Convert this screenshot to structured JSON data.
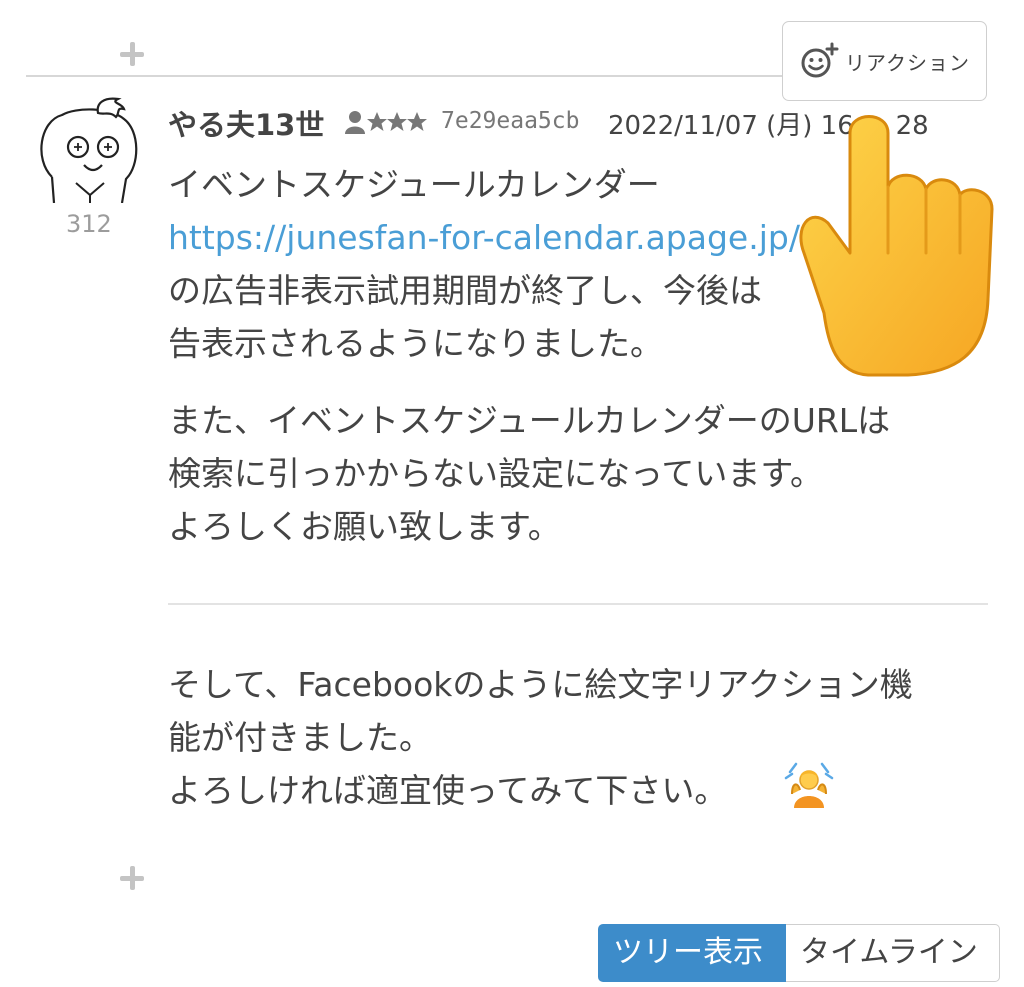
{
  "reaction_button": {
    "label": "リアクション",
    "icon": "smile-plus-icon"
  },
  "post": {
    "author": "やる夫13世",
    "rank_icon": "user-three-stars-icon",
    "id_hash": "7e29eaa5cb",
    "datetime": "2022/11/07 (月) 16:",
    "datetime_tail": "28",
    "number": "312",
    "paragraph1": {
      "line1": "イベントスケジュールカレンダー",
      "link": "https://junesfan-for-calendar.apage.jp/",
      "line3": "の広告非表示試用期間が終了し、今後は",
      "line4": "告表示されるようになりました。"
    },
    "paragraph2": {
      "line1": "また、イベントスケジュールカレンダーのURLは",
      "line2": "検索に引っかからない設定になっています。",
      "line3": "よろしくお願い致します。"
    },
    "paragraph3": {
      "line1": "そして、Facebookのように絵文字リアクション機",
      "line2": "能が付きました。",
      "line3": "よろしければ適宜使ってみて下さい。"
    },
    "emoji": "person-raising-hands-emoji"
  },
  "view_toggle": {
    "tree": "ツリー表示",
    "timeline": "タイムライン",
    "selected": "tree"
  },
  "colors": {
    "link": "#4a9ed6",
    "active_tab": "#3d8cca",
    "text": "#444444",
    "hand": "#f7b52b"
  }
}
